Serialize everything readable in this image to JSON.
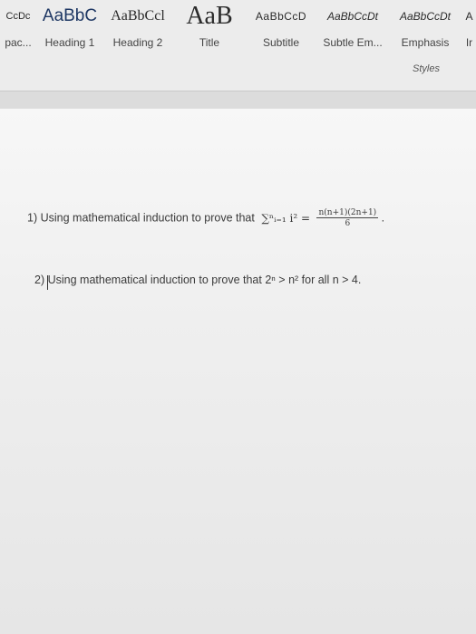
{
  "ribbon": {
    "styles": [
      {
        "sample": "CcDc",
        "name": "pac...",
        "font_size": 11
      },
      {
        "sample": "AaBbC",
        "name": "Heading 1",
        "font_size": 20
      },
      {
        "sample": "AaBbCcl",
        "name": "Heading 2",
        "font_size": 17
      },
      {
        "sample": "AaB",
        "name": "Title",
        "font_size": 30
      },
      {
        "sample": "AaBbCcD",
        "name": "Subtitle",
        "font_size": 12
      },
      {
        "sample": "AaBbCcDt",
        "name": "Subtle Em...",
        "font_size": 12
      },
      {
        "sample": "AaBbCcDt",
        "name": "Emphasis",
        "font_size": 12
      },
      {
        "sample": "A",
        "name": "Ir",
        "font_size": 12
      }
    ],
    "group_label": "Styles"
  },
  "document": {
    "q1": {
      "number": "1)",
      "text": "Using mathematical induction to prove that",
      "formula": "∑ⁿᵢ₌₁ i² =",
      "frac_num": "n(n+1)(2n+1)",
      "frac_den": "6",
      "tail": "."
    },
    "q2": {
      "number": "2)",
      "text": "Using mathematical induction to prove that 2ⁿ > n² for all n > 4."
    }
  }
}
